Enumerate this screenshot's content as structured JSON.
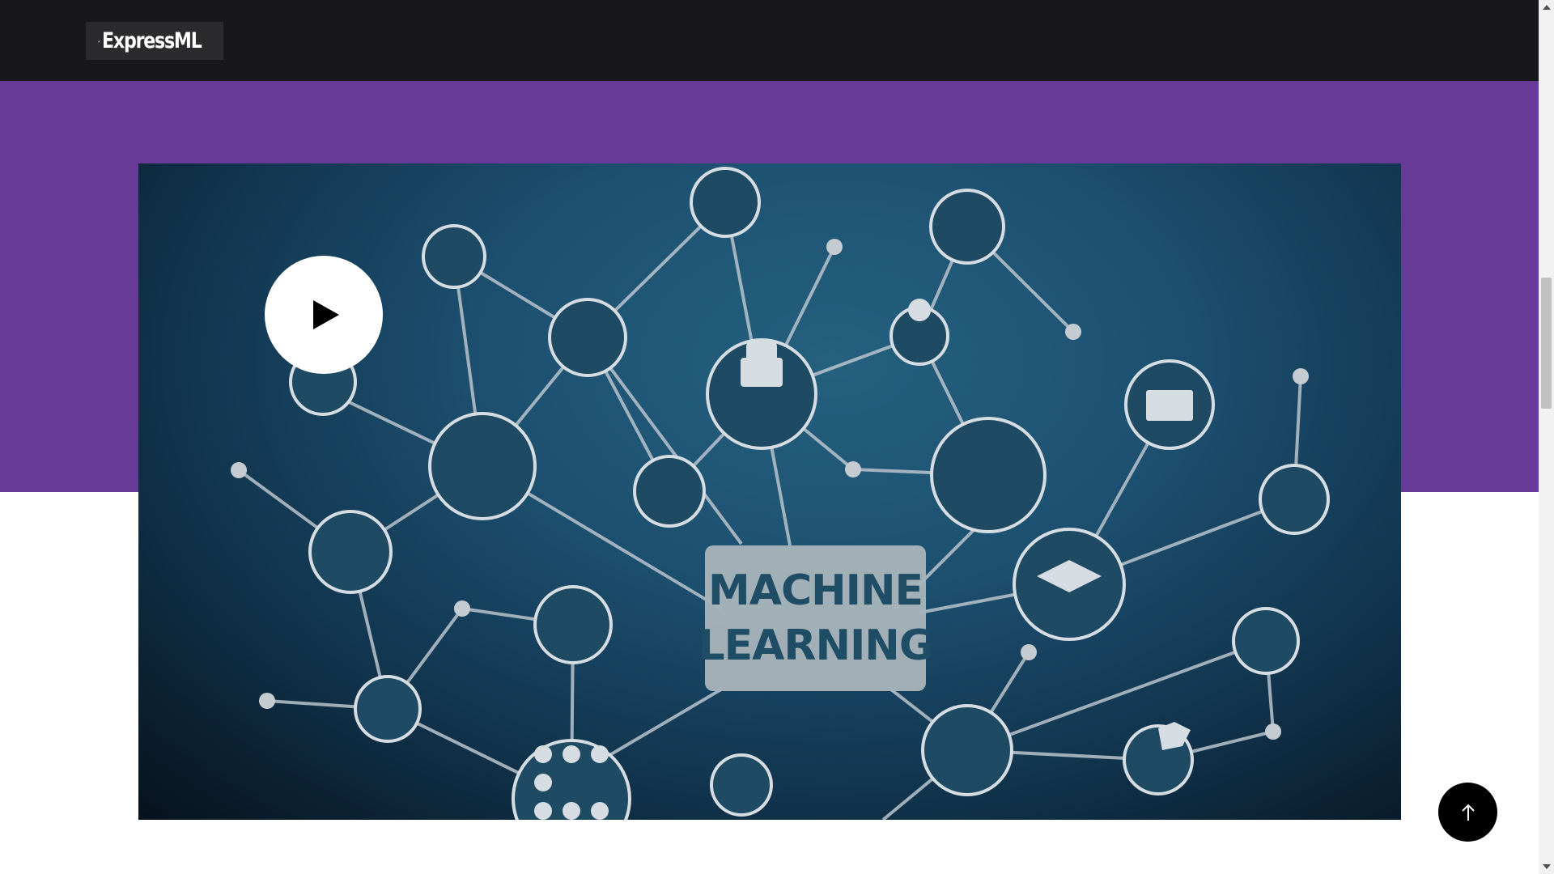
{
  "header": {
    "logo_text": "ExpressML"
  },
  "hero": {
    "video_title_lines": [
      "MACHINE",
      "LEARNING"
    ],
    "play_icon": "play-icon"
  },
  "scroll_top": {
    "icon": "arrow-up-icon"
  },
  "colors": {
    "header_bg": "#18181a",
    "band_bg": "#663a96",
    "video_bg": "#1d5070",
    "button_bg": "#000000"
  }
}
